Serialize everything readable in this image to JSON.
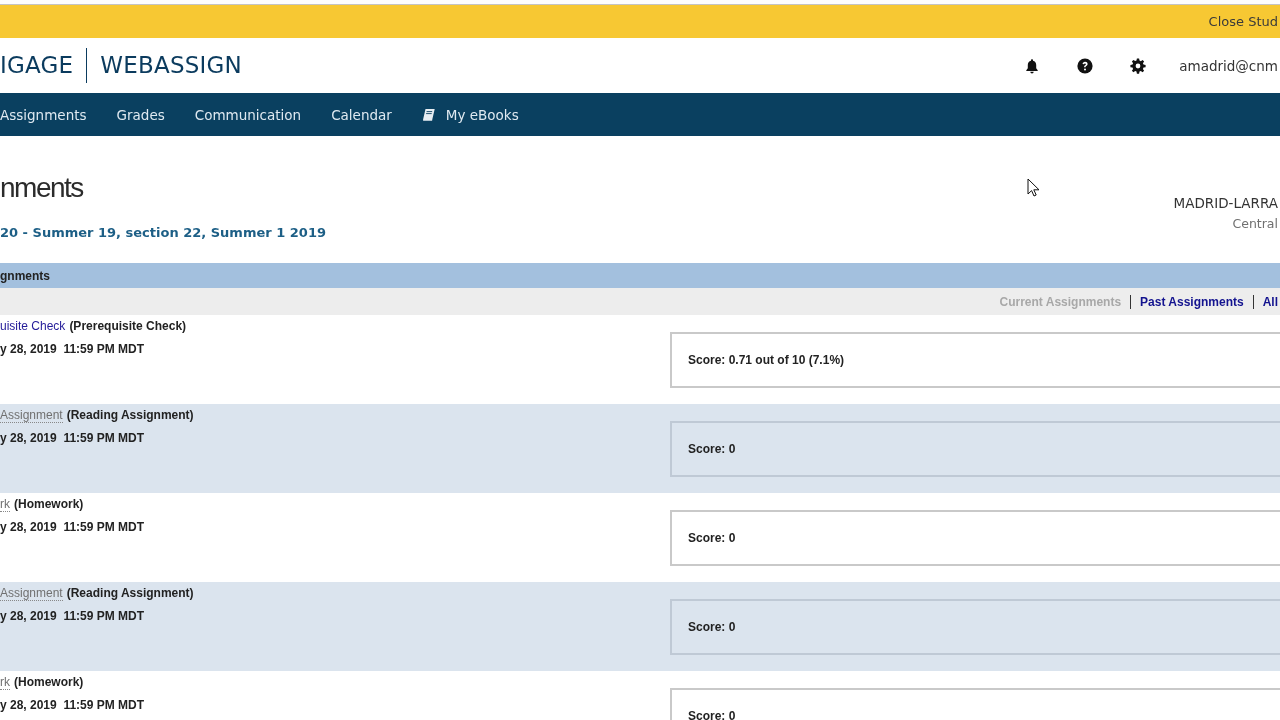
{
  "banner": {
    "link": "Close Stud"
  },
  "header": {
    "logo_left": "IGAGE",
    "logo_right": "WEBASSIGN",
    "user": "amadrid@cnm"
  },
  "nav": [
    {
      "label": "Assignments",
      "kind": "plain"
    },
    {
      "label": "Grades",
      "kind": "plain"
    },
    {
      "label": "Communication",
      "kind": "plain"
    },
    {
      "label": "Calendar",
      "kind": "plain"
    },
    {
      "label": "My eBooks",
      "kind": "ebooks"
    }
  ],
  "page": {
    "title": "nments",
    "course": "20 - Summer 19, section 22, Summer 1 2019",
    "instructor": "MADRID-LARRA",
    "school": "Central"
  },
  "assignments": {
    "header": "gnments",
    "filters": [
      {
        "label": "Current Assignments",
        "selected": true
      },
      {
        "label": "Past Assignments",
        "selected": false
      },
      {
        "label": "All",
        "selected": false
      }
    ],
    "rows": [
      {
        "name": "uisite Check",
        "available": true,
        "type": "(Prerequisite Check)",
        "due": "y 28, 2019  11:59 PM MDT",
        "score": "Score: 0.71 out of 10 (7.1%)"
      },
      {
        "name": "Assignment",
        "available": false,
        "type": "(Reading Assignment)",
        "due": "y 28, 2019  11:59 PM MDT",
        "score": "Score: 0"
      },
      {
        "name": "rk",
        "available": false,
        "type": "(Homework)",
        "due": "y 28, 2019  11:59 PM MDT",
        "score": "Score: 0"
      },
      {
        "name": "Assignment",
        "available": false,
        "type": "(Reading Assignment)",
        "due": "y 28, 2019  11:59 PM MDT",
        "score": "Score: 0"
      },
      {
        "name": "rk",
        "available": false,
        "type": "(Homework)",
        "due": "y 28, 2019  11:59 PM MDT",
        "score": "Score: 0"
      }
    ]
  }
}
